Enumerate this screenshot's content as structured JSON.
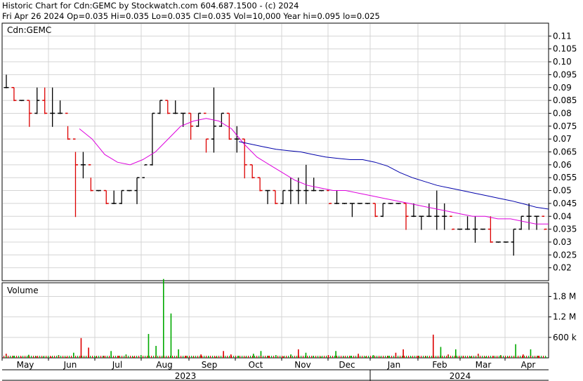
{
  "header": {
    "line1": "Historic Chart for Cdn:GEMC by Stockwatch.com 604.687.1500 - (c) 2024",
    "line2": "Fri Apr 26 2024   Op=0.035   Hi=0.035   Lo=0.035   Cl=0.035   Vol=10,000   Year hi=0.095   lo=0.025"
  },
  "chart_data": [
    {
      "type": "line",
      "title": "Cdn:GEMC",
      "ylim": [
        0.015,
        0.115
      ],
      "y_ticks": [
        "0.11",
        "0.105",
        "0.10",
        "0.095",
        "0.09",
        "0.085",
        "0.08",
        "0.075",
        "0.07",
        "0.065",
        "0.06",
        "0.055",
        "0.05",
        "0.045",
        "0.04",
        "0.035",
        "0.03",
        "0.025",
        "0.02"
      ],
      "x_months": [
        "May",
        "Jun",
        "Jul",
        "Aug",
        "Sep",
        "Oct",
        "Nov",
        "Dec",
        "Jan",
        "Feb",
        "Mar",
        "Apr"
      ],
      "x_years": [
        "2023",
        "2024"
      ],
      "grid": true,
      "price_bars": [
        [
          0.09,
          0.095,
          0.09
        ],
        [
          0.085,
          0.09,
          0.085
        ],
        [
          0.085,
          0.085,
          0.085
        ],
        [
          0.075,
          0.085,
          0.08
        ],
        [
          0.08,
          0.09,
          0.085
        ],
        [
          0.08,
          0.09,
          0.08
        ],
        [
          0.075,
          0.09,
          0.08
        ],
        [
          0.08,
          0.085,
          0.08
        ],
        [
          0.07,
          0.075,
          0.07
        ],
        [
          0.04,
          0.065,
          0.06
        ],
        [
          0.055,
          0.065,
          0.06
        ],
        [
          0.05,
          0.055,
          0.05
        ],
        [
          0.05,
          0.05,
          0.05
        ],
        [
          0.045,
          0.05,
          0.045
        ],
        [
          0.045,
          0.05,
          0.045
        ],
        [
          0.045,
          0.05,
          0.05
        ],
        [
          0.05,
          0.05,
          0.05
        ],
        [
          0.045,
          0.055,
          0.055
        ],
        [
          0.06,
          0.06,
          0.06
        ],
        [
          0.06,
          0.08,
          0.08
        ],
        [
          0.08,
          0.085,
          0.085
        ],
        [
          0.08,
          0.085,
          0.08
        ],
        [
          0.08,
          0.085,
          0.08
        ],
        [
          0.075,
          0.08,
          0.08
        ],
        [
          0.07,
          0.08,
          0.075
        ],
        [
          0.075,
          0.08,
          0.08
        ],
        [
          0.065,
          0.07,
          0.07
        ],
        [
          0.065,
          0.09,
          0.075
        ],
        [
          0.075,
          0.08,
          0.08
        ],
        [
          0.07,
          0.08,
          0.07
        ],
        [
          0.065,
          0.075,
          0.07
        ],
        [
          0.055,
          0.07,
          0.06
        ],
        [
          0.055,
          0.06,
          0.055
        ],
        [
          0.05,
          0.055,
          0.05
        ],
        [
          0.045,
          0.05,
          0.05
        ],
        [
          0.045,
          0.05,
          0.045
        ],
        [
          0.045,
          0.05,
          0.05
        ],
        [
          0.045,
          0.055,
          0.05
        ],
        [
          0.045,
          0.055,
          0.05
        ],
        [
          0.045,
          0.06,
          0.05
        ],
        [
          0.05,
          0.055,
          0.05
        ],
        [
          0.05,
          0.05,
          0.05
        ],
        [
          0.045,
          0.045,
          0.045
        ],
        [
          0.045,
          0.05,
          0.045
        ],
        [
          0.045,
          0.045,
          0.045
        ],
        [
          0.04,
          0.045,
          0.045
        ],
        [
          0.045,
          0.045,
          0.045
        ],
        [
          0.045,
          0.045,
          0.045
        ],
        [
          0.04,
          0.045,
          0.04
        ],
        [
          0.04,
          0.045,
          0.045
        ],
        [
          0.045,
          0.045,
          0.045
        ],
        [
          0.045,
          0.045,
          0.045
        ],
        [
          0.035,
          0.045,
          0.04
        ],
        [
          0.04,
          0.045,
          0.04
        ],
        [
          0.035,
          0.04,
          0.04
        ],
        [
          0.04,
          0.045,
          0.04
        ],
        [
          0.035,
          0.05,
          0.04
        ],
        [
          0.035,
          0.045,
          0.04
        ],
        [
          0.035,
          0.035,
          0.035
        ],
        [
          0.035,
          0.035,
          0.035
        ],
        [
          0.035,
          0.04,
          0.035
        ],
        [
          0.03,
          0.04,
          0.035
        ],
        [
          0.035,
          0.035,
          0.035
        ],
        [
          0.03,
          0.04,
          0.03
        ],
        [
          0.03,
          0.03,
          0.03
        ],
        [
          0.03,
          0.03,
          0.03
        ],
        [
          0.025,
          0.035,
          0.035
        ],
        [
          0.035,
          0.04,
          0.04
        ],
        [
          0.035,
          0.045,
          0.04
        ],
        [
          0.035,
          0.04,
          0.04
        ],
        [
          0.035,
          0.035,
          0.035
        ]
      ],
      "ma_short": [
        0.074,
        0.07,
        0.064,
        0.061,
        0.06,
        0.062,
        0.065,
        0.07,
        0.075,
        0.077,
        0.078,
        0.077,
        0.074,
        0.068,
        0.063,
        0.06,
        0.057,
        0.054,
        0.052,
        0.051,
        0.05,
        0.05,
        0.049,
        0.048,
        0.047,
        0.046,
        0.045,
        0.044,
        0.043,
        0.042,
        0.041,
        0.04,
        0.04,
        0.039,
        0.039,
        0.038,
        0.037,
        0.037
      ],
      "ma_long": [
        0.069,
        0.068,
        0.067,
        0.066,
        0.0655,
        0.065,
        0.064,
        0.063,
        0.0625,
        0.062,
        0.062,
        0.061,
        0.0595,
        0.057,
        0.055,
        0.0535,
        0.052,
        0.051,
        0.05,
        0.049,
        0.048,
        0.047,
        0.046,
        0.0448,
        0.0435,
        0.0428
      ]
    },
    {
      "type": "bar",
      "title": "Volume",
      "y_ticks": [
        "1.8 M",
        "1.2 M",
        "600 k"
      ],
      "ylim": [
        0,
        2200000
      ],
      "volumes": [
        [
          120000,
          "r"
        ],
        [
          60000,
          "g"
        ],
        [
          30000,
          "r"
        ],
        [
          90000,
          "g"
        ],
        [
          50000,
          "r"
        ],
        [
          40000,
          "g"
        ],
        [
          30000,
          "r"
        ],
        [
          80000,
          "g"
        ],
        [
          20000,
          "r"
        ],
        [
          150000,
          "g"
        ],
        [
          580000,
          "r"
        ],
        [
          300000,
          "r"
        ],
        [
          40000,
          "g"
        ],
        [
          60000,
          "r"
        ],
        [
          200000,
          "g"
        ],
        [
          60000,
          "r"
        ],
        [
          100000,
          "g"
        ],
        [
          30000,
          "r"
        ],
        [
          80000,
          "g"
        ],
        [
          700000,
          "g"
        ],
        [
          350000,
          "g"
        ],
        [
          2550000,
          "g"
        ],
        [
          1300000,
          "g"
        ],
        [
          250000,
          "g"
        ],
        [
          60000,
          "r"
        ],
        [
          40000,
          "g"
        ],
        [
          100000,
          "r"
        ],
        [
          50000,
          "g"
        ],
        [
          30000,
          "r"
        ],
        [
          200000,
          "r"
        ],
        [
          100000,
          "r"
        ],
        [
          60000,
          "g"
        ],
        [
          30000,
          "r"
        ],
        [
          120000,
          "g"
        ],
        [
          200000,
          "g"
        ],
        [
          60000,
          "r"
        ],
        [
          80000,
          "g"
        ],
        [
          40000,
          "r"
        ],
        [
          100000,
          "g"
        ],
        [
          250000,
          "r"
        ],
        [
          150000,
          "g"
        ],
        [
          60000,
          "g"
        ],
        [
          30000,
          "g"
        ],
        [
          80000,
          "r"
        ],
        [
          200000,
          "g"
        ],
        [
          50000,
          "r"
        ],
        [
          60000,
          "g"
        ],
        [
          120000,
          "r"
        ],
        [
          40000,
          "g"
        ],
        [
          80000,
          "g"
        ],
        [
          30000,
          "r"
        ],
        [
          60000,
          "g"
        ],
        [
          150000,
          "r"
        ],
        [
          250000,
          "r"
        ],
        [
          40000,
          "g"
        ],
        [
          60000,
          "r"
        ],
        [
          50000,
          "g"
        ],
        [
          680000,
          "r"
        ],
        [
          320000,
          "g"
        ],
        [
          100000,
          "r"
        ],
        [
          250000,
          "g"
        ],
        [
          60000,
          "r"
        ],
        [
          40000,
          "g"
        ],
        [
          120000,
          "r"
        ],
        [
          30000,
          "g"
        ],
        [
          60000,
          "r"
        ],
        [
          80000,
          "g"
        ],
        [
          30000,
          "r"
        ],
        [
          400000,
          "g"
        ],
        [
          100000,
          "r"
        ],
        [
          250000,
          "g"
        ],
        [
          60000,
          "r"
        ],
        [
          30000,
          "g"
        ]
      ]
    }
  ],
  "colors": {
    "up": "#000000",
    "down": "#dd0000",
    "ma_short": "#dd00dd",
    "ma_long": "#0000aa",
    "vol_up": "#00aa00",
    "vol_down": "#dd0000",
    "grid": "#d4d4d4",
    "axis": "#000000"
  }
}
